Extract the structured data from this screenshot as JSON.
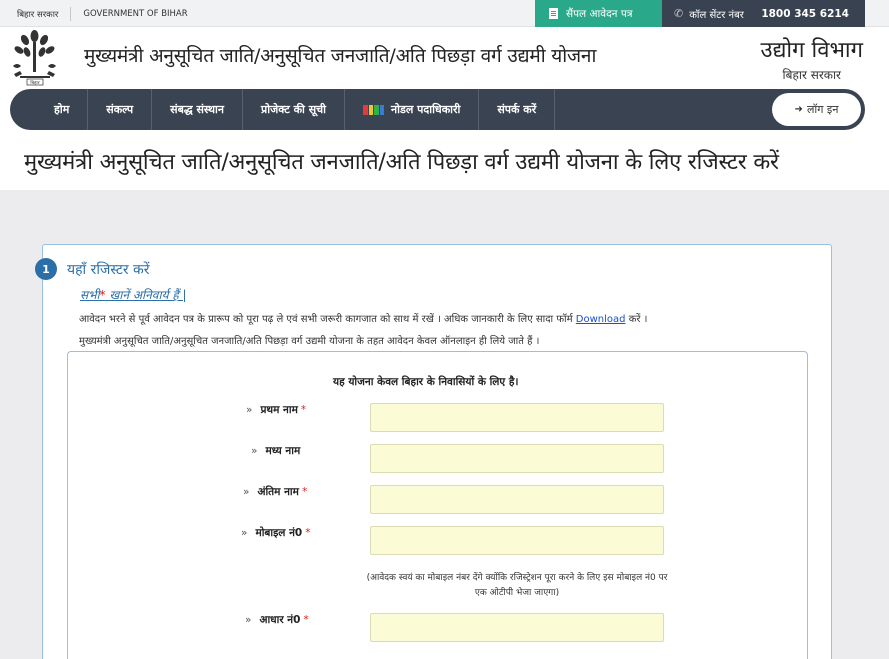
{
  "topbar": {
    "state": "बिहार सरकार",
    "govt": "GOVERNMENT OF BIHAR",
    "sample_form": "सैंपल आवेदन पत्र",
    "call_center": "कॉल सेंटर नंबर",
    "call_number": "1800 345 6214"
  },
  "header": {
    "scheme_title": "मुख्यमंत्री अनुसूचित जाति/अनुसूचित जनजाति/अति पिछड़ा वर्ग उद्यमी योजना",
    "dept_name": "उद्योग विभाग",
    "dept_sub": "बिहार सरकार",
    "emblem_caption": "बिहार"
  },
  "nav": {
    "items": [
      "होम",
      "संकल्प",
      "संबद्ध संस्थान",
      "प्रोजेक्ट की सूची",
      "नोडल पदाधिकारी",
      "संपर्क करें"
    ],
    "login": "लॉग इन"
  },
  "page_heading": "मुख्यमंत्री अनुसूचित जाति/अनुसूचित जनजाति/अति पिछड़ा वर्ग उद्यमी योजना के लिए रजिस्टर करें",
  "form": {
    "step_number": "1",
    "title": "यहाँ रजिस्टर करें",
    "mandatory_pre": "सभी",
    "mandatory_star": "*",
    "mandatory_post": " खानें अनिवार्य हैं ",
    "mandatory_bar": "|",
    "info_line1_pre": "आवेदन भरने से पूर्व आवेदन पत्र के प्रारूप को पूरा पढ़ ले एवं सभी जरूरी कागजात को साथ में रखें । अधिक जानकारी के लिए सादा फॉर्म ",
    "info_line1_link": "Download",
    "info_line1_post": " करें ।",
    "info_line2": "मुख्यमंत्री अनुसूचित जाति/अनुसूचित जनजाति/अति पिछड़ा वर्ग उद्यमी योजना के तहत आवेदन केवल ऑनलाइन ही लिये जाते हैं ।",
    "notice": "यह योजना केवल बिहार के निवासियों के लिए है।",
    "marker": "»",
    "required_mark": "*",
    "fields": [
      {
        "label": "प्रथम नाम",
        "value": ""
      },
      {
        "label": "मध्य नाम",
        "value": ""
      },
      {
        "label": "अंतिम नाम",
        "value": ""
      },
      {
        "label": "मोबाइल नं0",
        "value": ""
      },
      {
        "label": "आधार नं0",
        "value": ""
      }
    ],
    "mobile_hint": "(आवेदक स्वयं का मोबाइल नंबर देंगे क्योंकि रजिस्ट्रेशन पूरा करने के लिए इस मोबाइल नं0 पर एक ओटीपी भेजा जाएगा)"
  },
  "colors": {
    "nav_bg": "#3a4351",
    "sample_btn": "#2aa88a",
    "accent_blue": "#2b6ea8",
    "input_bg": "#fbfbd5",
    "required": "#e01e1e"
  }
}
